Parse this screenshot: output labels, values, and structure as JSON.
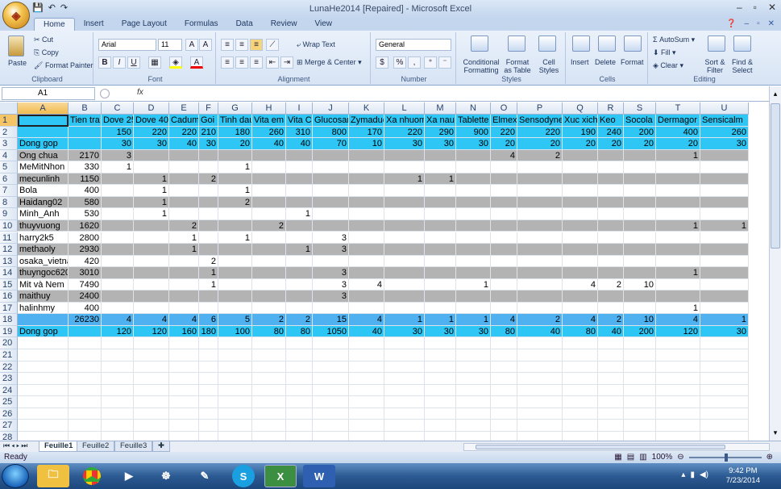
{
  "app": {
    "title": "LunaHe2014 [Repaired] - Microsoft Excel",
    "window_controls": [
      "–",
      "▫",
      "✕"
    ]
  },
  "ribbon_tabs": [
    "Home",
    "Insert",
    "Page Layout",
    "Formulas",
    "Data",
    "Review",
    "View"
  ],
  "ribbon": {
    "clipboard": {
      "paste": "Paste",
      "cut": "Cut",
      "copy": "Copy",
      "format_painter": "Format Painter",
      "label": "Clipboard"
    },
    "font": {
      "name": "Arial",
      "size": "11",
      "label": "Font",
      "bold": "B",
      "italic": "I",
      "underline": "U"
    },
    "alignment": {
      "wrap": "Wrap Text",
      "merge": "Merge & Center",
      "label": "Alignment"
    },
    "number": {
      "format": "General",
      "label": "Number",
      "currency": "$",
      "percent": "%",
      "comma": ","
    },
    "styles": {
      "conditional": "Conditional Formatting",
      "format_table": "Format as Table",
      "cell_styles": "Cell Styles",
      "label": "Styles"
    },
    "cells": {
      "insert": "Insert",
      "delete": "Delete",
      "format": "Format",
      "label": "Cells"
    },
    "editing": {
      "autosum": "AutoSum",
      "fill": "Fill",
      "clear": "Clear",
      "sort": "Sort & Filter",
      "find": "Find & Select",
      "label": "Editing"
    }
  },
  "formula_bar": {
    "name_box": "A1",
    "fx": "fx",
    "formula": ""
  },
  "columns": [
    "A",
    "B",
    "C",
    "D",
    "E",
    "F",
    "G",
    "H",
    "I",
    "J",
    "K",
    "L",
    "M",
    "N",
    "O",
    "P",
    "Q",
    "R",
    "S",
    "T",
    "U"
  ],
  "rows": [
    [
      "",
      "Tien tra",
      "Dove 25",
      "Dove 40",
      "Cadum",
      "Goi",
      "Tinh dau",
      "Vita em",
      "Vita C",
      "Glucosar",
      "Zymaduc",
      "Xa nhuom",
      "Xa nau",
      "Tablette",
      "Elmex",
      "Sensodyne",
      "Xuc xich",
      "Keo",
      "Socola",
      "Dermagor",
      "Sensicalm"
    ],
    [
      "",
      "",
      "150",
      "220",
      "220",
      "210",
      "180",
      "260",
      "310",
      "800",
      "170",
      "220",
      "290",
      "900",
      "220",
      "220",
      "190",
      "240",
      "200",
      "400",
      "260"
    ],
    [
      "Dong gop",
      "",
      "30",
      "30",
      "40",
      "30",
      "20",
      "40",
      "40",
      "70",
      "10",
      "30",
      "30",
      "30",
      "20",
      "20",
      "20",
      "20",
      "20",
      "20",
      "30"
    ],
    [
      "Ong chua",
      "2170",
      "3",
      "",
      "",
      "",
      "",
      "",
      "",
      "",
      "",
      "",
      "",
      "",
      "4",
      "2",
      "",
      "",
      "",
      "1",
      ""
    ],
    [
      "MeMitNhon",
      "330",
      "1",
      "",
      "",
      "",
      "1",
      "",
      "",
      "",
      "",
      "",
      "",
      "",
      "",
      "",
      "",
      "",
      "",
      "",
      ""
    ],
    [
      "mecunlinh",
      "1150",
      "",
      "1",
      "",
      "2",
      "",
      "",
      "",
      "",
      "",
      "1",
      "1",
      "",
      "",
      "",
      "",
      "",
      "",
      "",
      ""
    ],
    [
      "Bola",
      "400",
      "",
      "1",
      "",
      "",
      "1",
      "",
      "",
      "",
      "",
      "",
      "",
      "",
      "",
      "",
      "",
      "",
      "",
      "",
      ""
    ],
    [
      "Haidang02",
      "580",
      "",
      "1",
      "",
      "",
      "2",
      "",
      "",
      "",
      "",
      "",
      "",
      "",
      "",
      "",
      "",
      "",
      "",
      "",
      ""
    ],
    [
      "Minh_Anh",
      "530",
      "",
      "1",
      "",
      "",
      "",
      "",
      "1",
      "",
      "",
      "",
      "",
      "",
      "",
      "",
      "",
      "",
      "",
      "",
      ""
    ],
    [
      "thuyvuong",
      "1620",
      "",
      "",
      "2",
      "",
      "",
      "2",
      "",
      "",
      "",
      "",
      "",
      "",
      "",
      "",
      "",
      "",
      "",
      "1",
      "1"
    ],
    [
      "harry2k5",
      "2800",
      "",
      "",
      "1",
      "",
      "1",
      "",
      "",
      "3",
      "",
      "",
      "",
      "",
      "",
      "",
      "",
      "",
      "",
      "",
      ""
    ],
    [
      "methaoly",
      "2930",
      "",
      "",
      "1",
      "",
      "",
      "",
      "1",
      "3",
      "",
      "",
      "",
      "",
      "",
      "",
      "",
      "",
      "",
      "",
      ""
    ],
    [
      "osaka_vietna",
      "420",
      "",
      "",
      "",
      "2",
      "",
      "",
      "",
      "",
      "",
      "",
      "",
      "",
      "",
      "",
      "",
      "",
      "",
      "",
      ""
    ],
    [
      "thuyngoc620",
      "3010",
      "",
      "",
      "",
      "1",
      "",
      "",
      "",
      "3",
      "",
      "",
      "",
      "",
      "",
      "",
      "",
      "",
      "",
      "1",
      ""
    ],
    [
      "Mit và Nem",
      "7490",
      "",
      "",
      "",
      "1",
      "",
      "",
      "",
      "3",
      "4",
      "",
      "",
      "1",
      "",
      "",
      "4",
      "2",
      "10",
      "",
      ""
    ],
    [
      "maithuy",
      "2400",
      "",
      "",
      "",
      "",
      "",
      "",
      "",
      "3",
      "",
      "",
      "",
      "",
      "",
      "",
      "",
      "",
      "",
      "",
      ""
    ],
    [
      "halinhmy",
      "400",
      "",
      "",
      "",
      "",
      "",
      "",
      "",
      "",
      "",
      "",
      "",
      "",
      "",
      "",
      "",
      "",
      "",
      "1",
      ""
    ],
    [
      "",
      "26230",
      "4",
      "4",
      "4",
      "6",
      "5",
      "2",
      "2",
      "15",
      "4",
      "1",
      "1",
      "1",
      "4",
      "2",
      "4",
      "2",
      "10",
      "4",
      "1"
    ],
    [
      "Dong gop",
      "",
      "120",
      "120",
      "160",
      "180",
      "100",
      "80",
      "80",
      "1050",
      "40",
      "30",
      "30",
      "30",
      "80",
      "40",
      "80",
      "40",
      "200",
      "120",
      "30"
    ]
  ],
  "empty_rows": [
    "20",
    "21",
    "22",
    "23",
    "24",
    "25",
    "26",
    "27",
    "28"
  ],
  "sheets": [
    "Feuille1",
    "Feuille2",
    "Feuille3"
  ],
  "status": {
    "ready": "Ready",
    "zoom": "100%"
  },
  "taskbar": {
    "time": "9:42 PM",
    "date": "7/23/2014"
  },
  "colors": {
    "cyan": "#2dc6f5",
    "gray": "#b3b3b3",
    "blue": "#4fb1f0",
    "selection": "#f4c465"
  }
}
